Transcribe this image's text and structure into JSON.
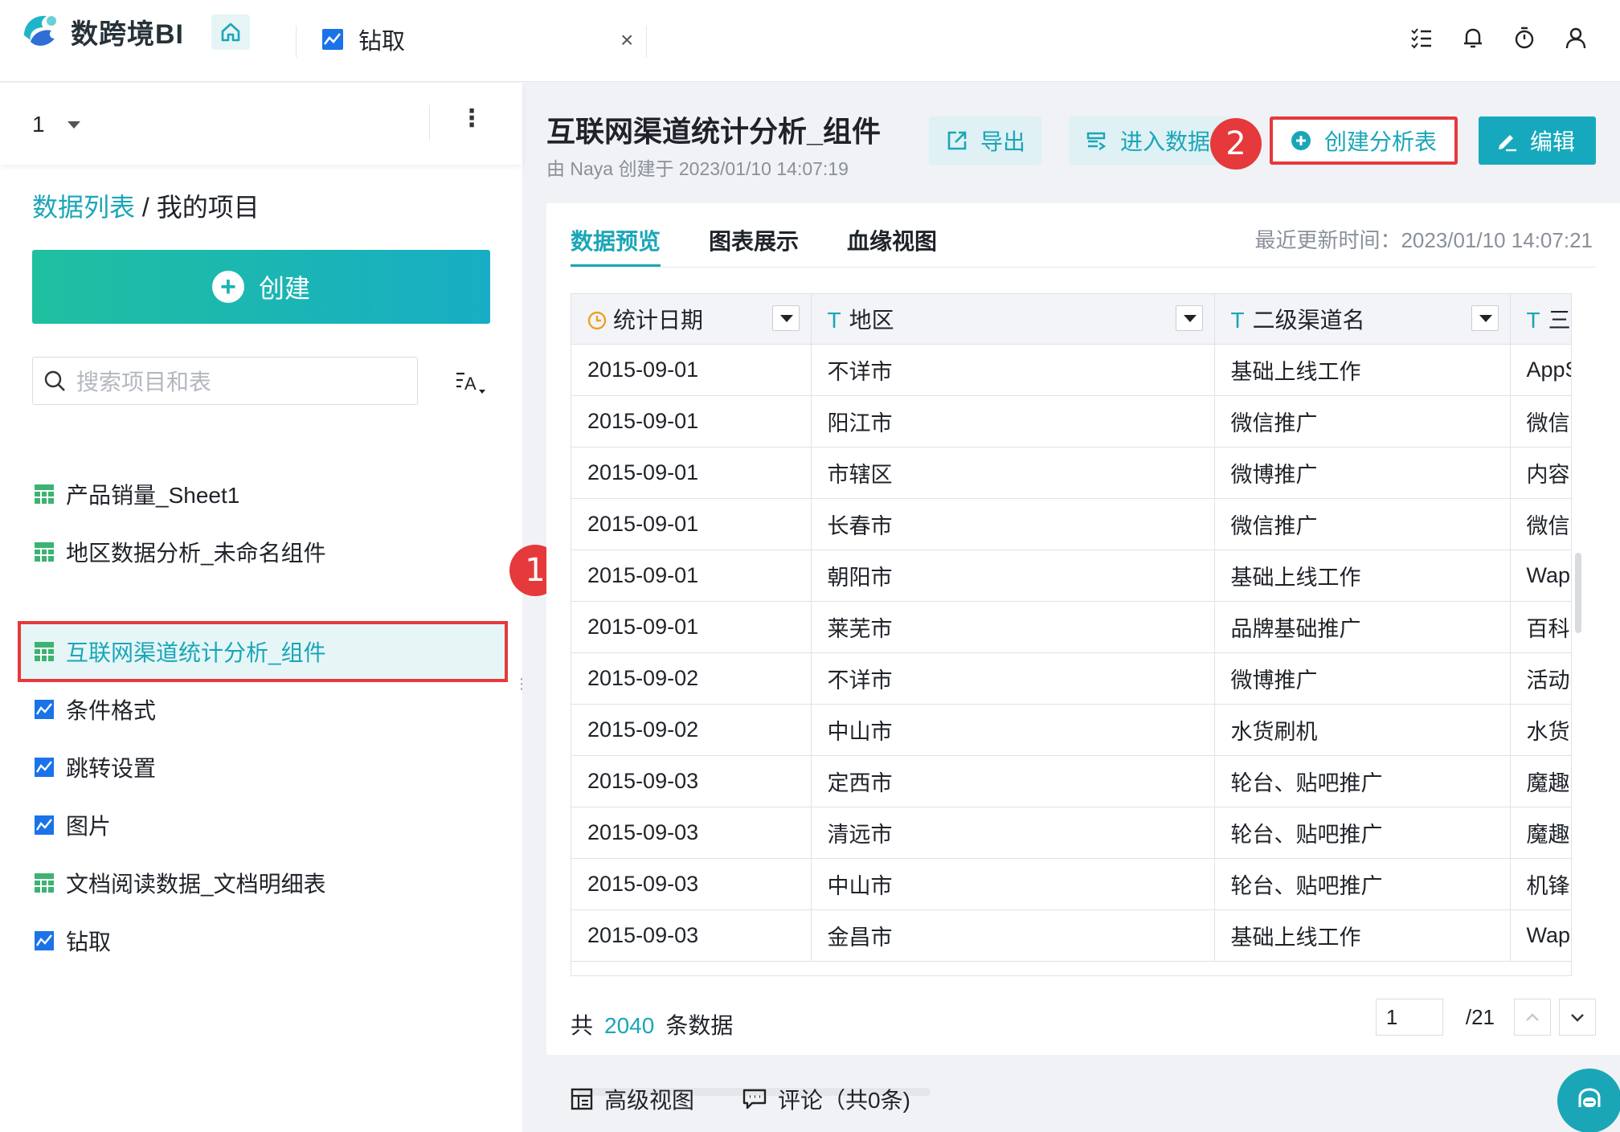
{
  "app": {
    "name": "数跨境BI"
  },
  "tabs": [
    {
      "label": "钻取",
      "close": "×"
    }
  ],
  "sidebar": {
    "project_number": "1",
    "more": "⋮",
    "breadcrumb": {
      "root": "数据列表",
      "sep": " / ",
      "current": "我的项目"
    },
    "create_label": "创建",
    "search_placeholder": "搜索项目和表",
    "items": [
      {
        "label": "产品销量_Sheet1",
        "icon": "table-icon"
      },
      {
        "label": "地区数据分析_未命名组件",
        "icon": "table-icon"
      },
      {
        "label": "互联网渠道统计分析_组件",
        "icon": "table-icon",
        "active": true
      },
      {
        "label": "条件格式",
        "icon": "chart-icon"
      },
      {
        "label": "跳转设置",
        "icon": "chart-icon"
      },
      {
        "label": "图片",
        "icon": "chart-icon"
      },
      {
        "label": "文档阅读数据_文档明细表",
        "icon": "table-icon"
      },
      {
        "label": "钻取",
        "icon": "chart-icon"
      }
    ]
  },
  "annotations": {
    "badge1": "1",
    "badge2": "2"
  },
  "main": {
    "title": "互联网渠道统计分析_组件",
    "subtitle": "由 Naya 创建于 2023/01/10 14:07:19",
    "actions": {
      "export": "导出",
      "enter_data": "进入数据",
      "create_analysis": "创建分析表",
      "edit": "编辑"
    },
    "tabs": [
      "数据预览",
      "图表展示",
      "血缘视图"
    ],
    "updated": "最近更新时间：2023/01/10 14:07:21",
    "table": {
      "columns": [
        {
          "type_icon": "clock-icon",
          "label": "统计日期"
        },
        {
          "type_icon": "T",
          "label": "地区"
        },
        {
          "type_icon": "T",
          "label": "二级渠道名"
        },
        {
          "type_icon": "T",
          "label": "三"
        }
      ],
      "rows": [
        [
          "2015-09-01",
          "不详市",
          "基础上线工作",
          "AppS"
        ],
        [
          "2015-09-01",
          "阳江市",
          "微信推广",
          "微信"
        ],
        [
          "2015-09-01",
          "市辖区",
          "微博推广",
          "内容"
        ],
        [
          "2015-09-01",
          "长春市",
          "微信推广",
          "微信"
        ],
        [
          "2015-09-01",
          "朝阳市",
          "基础上线工作",
          "Wap"
        ],
        [
          "2015-09-01",
          "莱芜市",
          "品牌基础推广",
          "百科"
        ],
        [
          "2015-09-02",
          "不详市",
          "微博推广",
          "活动"
        ],
        [
          "2015-09-02",
          "中山市",
          "水货刷机",
          "水货"
        ],
        [
          "2015-09-03",
          "定西市",
          "轮台、贴吧推广",
          "魔趣"
        ],
        [
          "2015-09-03",
          "清远市",
          "轮台、贴吧推广",
          "魔趣"
        ],
        [
          "2015-09-03",
          "中山市",
          "轮台、贴吧推广",
          "机锋"
        ],
        [
          "2015-09-03",
          "金昌市",
          "基础上线工作",
          "Wap"
        ]
      ]
    },
    "footer": {
      "prefix": "共",
      "count": "2040",
      "suffix": "条数据",
      "page": "1",
      "total_pages": "/21"
    },
    "bottom": {
      "advanced_view": "高级视图",
      "comments": "评论（共0条)"
    }
  },
  "colors": {
    "accent": "#1aa6b7",
    "highlight": "#e5393b"
  }
}
